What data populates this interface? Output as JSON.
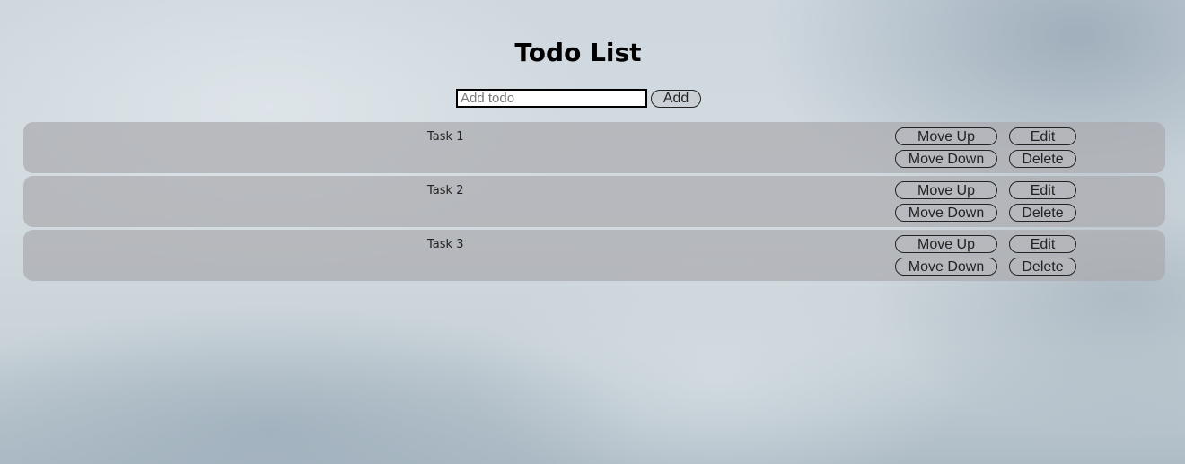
{
  "header": {
    "title": "Todo List"
  },
  "add_form": {
    "input_value": "",
    "input_placeholder": "Add todo",
    "add_label": "Add"
  },
  "todos": [
    {
      "text": "Task 1",
      "move_up_label": "Move Up",
      "edit_label": "Edit",
      "move_down_label": "Move Down",
      "delete_label": "Delete"
    },
    {
      "text": "Task 2",
      "move_up_label": "Move Up",
      "edit_label": "Edit",
      "move_down_label": "Move Down",
      "delete_label": "Delete"
    },
    {
      "text": "Task 3",
      "move_up_label": "Move Up",
      "edit_label": "Edit",
      "move_down_label": "Move Down",
      "delete_label": "Delete"
    }
  ]
}
